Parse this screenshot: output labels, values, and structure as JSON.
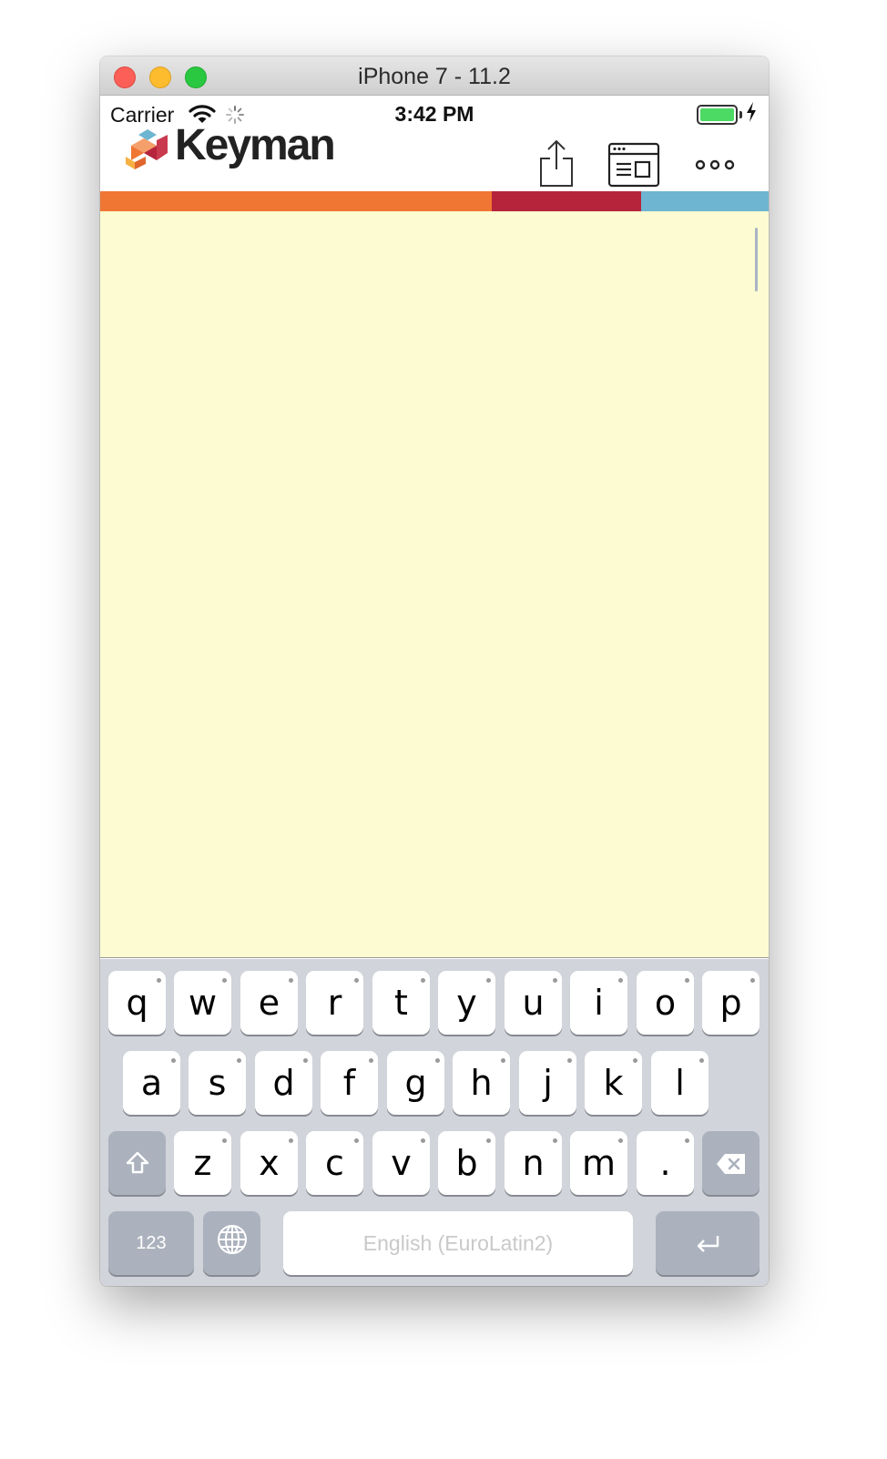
{
  "window": {
    "title": "iPhone 7 - 11.2"
  },
  "status_bar": {
    "carrier": "Carrier",
    "time": "3:42 PM"
  },
  "app": {
    "logo_text": "Keyman"
  },
  "colors": {
    "stripe_orange": "#f07634",
    "stripe_red": "#b5243b",
    "stripe_blue": "#6eb5d1",
    "text_area_bg": "#fdfbd1",
    "battery_green": "#4cd964"
  },
  "icons": {
    "share": "share-icon",
    "browser": "browser-icon",
    "more": "more-icon",
    "shift": "shift-icon",
    "backspace": "backspace-icon",
    "globe": "globe-icon",
    "return": "return-icon"
  },
  "keyboard": {
    "row1": [
      "q",
      "w",
      "e",
      "r",
      "t",
      "y",
      "u",
      "i",
      "o",
      "p"
    ],
    "row2": [
      "a",
      "s",
      "d",
      "f",
      "g",
      "h",
      "j",
      "k",
      "l"
    ],
    "row3": [
      "z",
      "x",
      "c",
      "v",
      "b",
      "n",
      "m",
      "."
    ],
    "numbers_label": "123",
    "space_label": "English (EuroLatin2)"
  }
}
